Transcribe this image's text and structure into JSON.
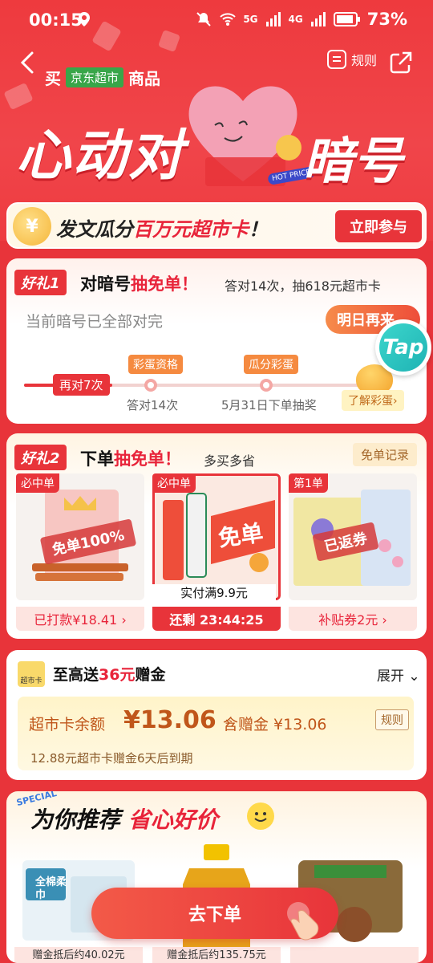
{
  "status_bar": {
    "time": "00:15",
    "battery": "73%",
    "signal_5g": "5G",
    "signal_4g": "4G"
  },
  "header": {
    "buy_prefix": "买",
    "badge": "京东超市",
    "buy_suffix": "商品",
    "rules_label": "规则",
    "hero_title_a": "心动对",
    "hero_title_b": "暗号",
    "hot_price": "HOT PRICE"
  },
  "banner": {
    "text_a": "发文瓜分",
    "text_hl": "百万元超市卡",
    "text_b": "！",
    "coin": "¥",
    "button": "立即参与"
  },
  "gift1": {
    "tag": "好礼1",
    "title_a": "对暗号",
    "title_hl": "抽免单",
    "title_b": "！",
    "subtitle": "答对14次，抽618元超市卡",
    "status": "当前暗号已全部对完",
    "button": "明日再来",
    "progress_pill": "再对7次",
    "node1_tag": "彩蛋资格",
    "node1_label": "答对14次",
    "node2_tag": "瓜分彩蛋",
    "node2_label": "5月31日下单抽奖",
    "egg_link": "了解彩蛋›"
  },
  "tap": {
    "label": "Tap"
  },
  "gift2": {
    "tag": "好礼2",
    "title_a": "下单",
    "title_hl": "抽免单",
    "title_b": "！",
    "subtitle": "多买多省",
    "record_btn": "免单记录",
    "products": [
      {
        "tag": "必中单",
        "stamp": "免单100%",
        "bottom": "已打款¥18.41 ›"
      },
      {
        "tag": "必中单",
        "stamp": "免单",
        "note": "实付满9.9元",
        "bottom": "还剩 23:44:25"
      },
      {
        "tag": "第1单",
        "stamp": "已返券",
        "bottom": "补贴券2元 ›"
      }
    ]
  },
  "card": {
    "icon": "超市卡",
    "title_a": "至高送",
    "title_hl": "36元",
    "title_b": "赠金",
    "expand": "展开",
    "balance_label": "超市卡余额",
    "balance_value": "¥13.06",
    "balance_sub": "含赠金 ¥13.06",
    "rules": "规则",
    "expire": "12.88元超市卡赠金6天后到期"
  },
  "recommend": {
    "special": "SPECIAL",
    "title_a": "为你推荐",
    "title_hl": "省心好价",
    "items": [
      {
        "label": "全棉柔巾",
        "price": "赠金抵后约40.02元"
      },
      {
        "label": "",
        "price": "赠金抵后约135.75元"
      },
      {
        "label": "",
        "price": ""
      }
    ]
  },
  "cta": {
    "label": "去下单"
  },
  "colors": {
    "primary": "#e8343a",
    "green_badge": "#39a649",
    "gold": "#f5b63a"
  }
}
